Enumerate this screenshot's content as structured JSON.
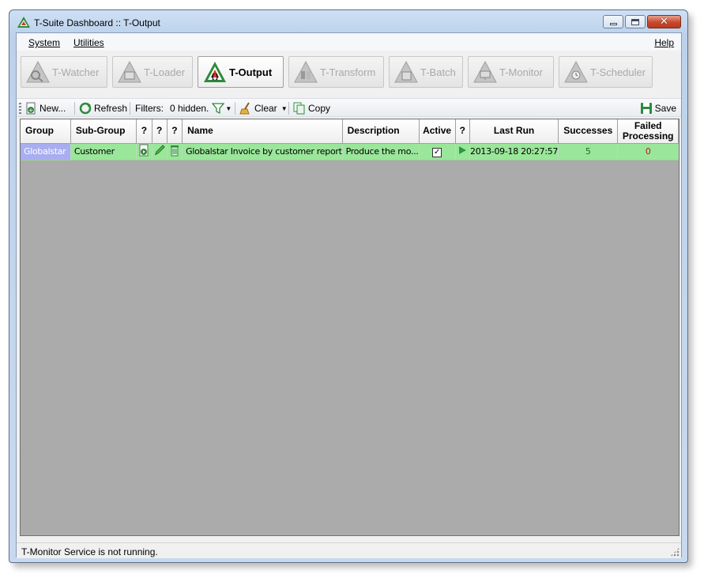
{
  "window": {
    "title": "T-Suite Dashboard :: T-Output"
  },
  "menu": {
    "system": "System",
    "utilities": "Utilities",
    "help": "Help"
  },
  "modules": [
    {
      "label": "T-Watcher",
      "active": false
    },
    {
      "label": "T-Loader",
      "active": false
    },
    {
      "label": "T-Output",
      "active": true
    },
    {
      "label": "T-Transform",
      "active": false
    },
    {
      "label": "T-Batch",
      "active": false
    },
    {
      "label": "T-Monitor",
      "active": false
    },
    {
      "label": "T-Scheduler",
      "active": false
    }
  ],
  "toolbar": {
    "new_label": "New...",
    "refresh_label": "Refresh",
    "filters_label": "Filters:",
    "hidden_label": "0 hidden.",
    "clear_label": "Clear",
    "copy_label": "Copy",
    "save_label": "Save"
  },
  "grid": {
    "headers": {
      "group": "Group",
      "subgroup": "Sub-Group",
      "q1": "?",
      "q2": "?",
      "q3": "?",
      "name": "Name",
      "description": "Description",
      "active": "Active",
      "q4": "?",
      "last_run": "Last Run",
      "successes": "Successes",
      "failed": "Failed Processing"
    },
    "rows": [
      {
        "group": "Globalstar",
        "subgroup": "Customer",
        "name": "Globalstar Invoice by customer report",
        "description": "Produce the mo...",
        "active": true,
        "last_run": "2013-09-18 20:27:57",
        "successes": "5",
        "failed": "0"
      }
    ]
  },
  "status": {
    "text": "T-Monitor Service is not running."
  },
  "colors": {
    "row_bg": "#9ae69a",
    "group_cell": "#a9aef0",
    "grid_bg": "#ababab",
    "close_button": "#c9472d"
  }
}
